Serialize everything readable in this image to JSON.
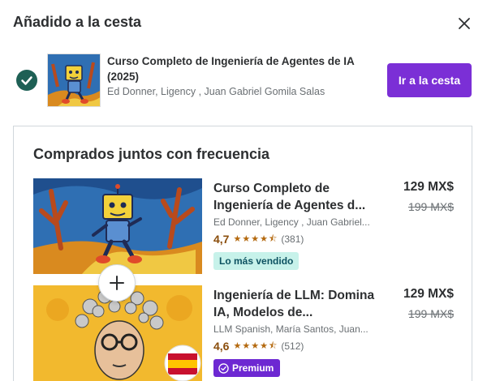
{
  "modal": {
    "title": "Añadido a la cesta",
    "close_icon": "close-icon"
  },
  "added_course": {
    "title": "Curso Completo de Ingeniería de Agentes de IA (2025)",
    "authors": "Ed Donner, Ligency , Juan Gabriel Gomila Salas",
    "status_icon": "check-circle-icon",
    "cta_label": "Ir a la cesta"
  },
  "bundle": {
    "title": "Comprados juntos con frecuencia",
    "plus_icon": "plus-icon",
    "items": [
      {
        "title": "Curso Completo de Ingeniería de Agentes d...",
        "authors": "Ed Donner, Ligency , Juan Gabriel...",
        "rating": "4,7",
        "stars": 4.5,
        "reviews": "(381)",
        "badge": "Lo más vendido",
        "price": "129 MX$",
        "old_price": "199 MX$"
      },
      {
        "title": "Ingeniería de LLM: Domina IA, Modelos de...",
        "authors": "LLM Spanish, María Santos, Juan...",
        "rating": "4,6",
        "stars": 4.5,
        "reviews": "(512)",
        "badge": "Premium",
        "price": "129 MX$",
        "old_price": "199 MX$"
      }
    ]
  },
  "colors": {
    "primary": "#7b2fd6",
    "success": "#1e6055",
    "rating": "#b4690e",
    "bestseller_bg": "#c7f2ea",
    "premium_bg": "#6d28d2"
  }
}
